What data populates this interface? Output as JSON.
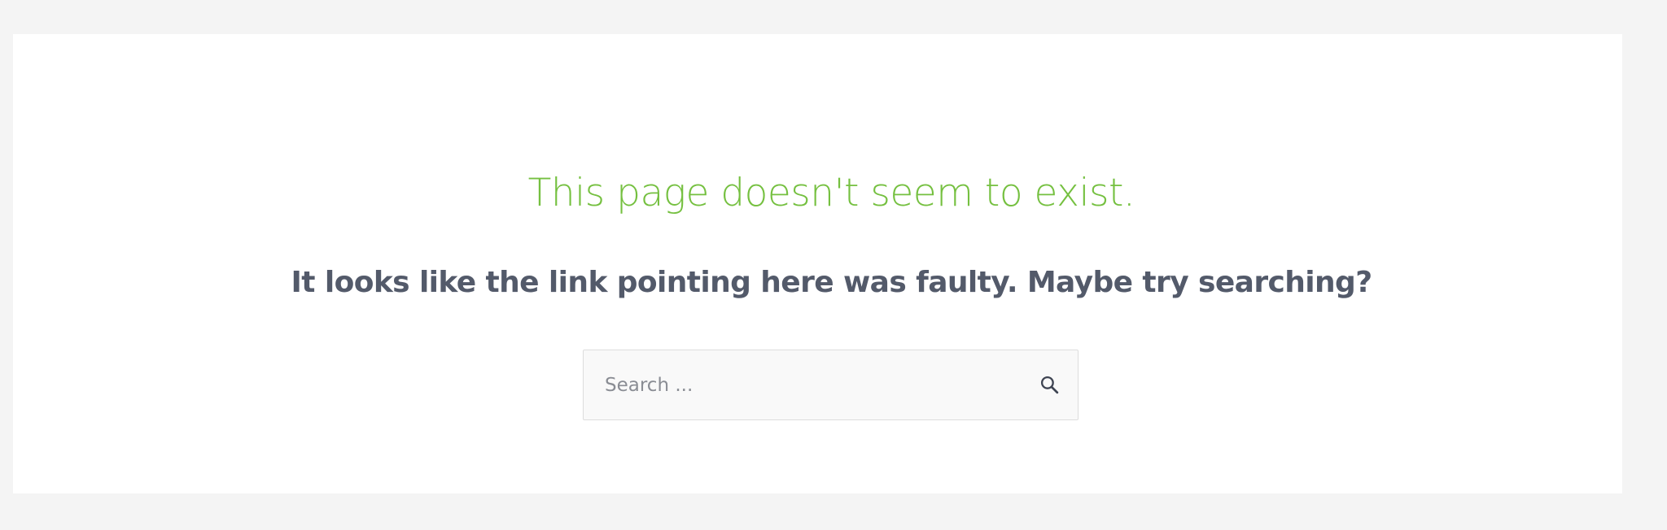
{
  "error": {
    "title": "This page doesn't seem to exist.",
    "subtitle": "It looks like the link pointing here was faulty. Maybe try searching?"
  },
  "search": {
    "placeholder": "Search ...",
    "value": "",
    "button_icon": "search-icon"
  },
  "colors": {
    "page_background": "#f4f4f4",
    "card_background": "#ffffff",
    "title_accent": "#75c040",
    "subtitle_text": "#535a6a",
    "search_background": "#f9f9f9",
    "search_border": "#dddddd",
    "icon": "#3e4452"
  }
}
